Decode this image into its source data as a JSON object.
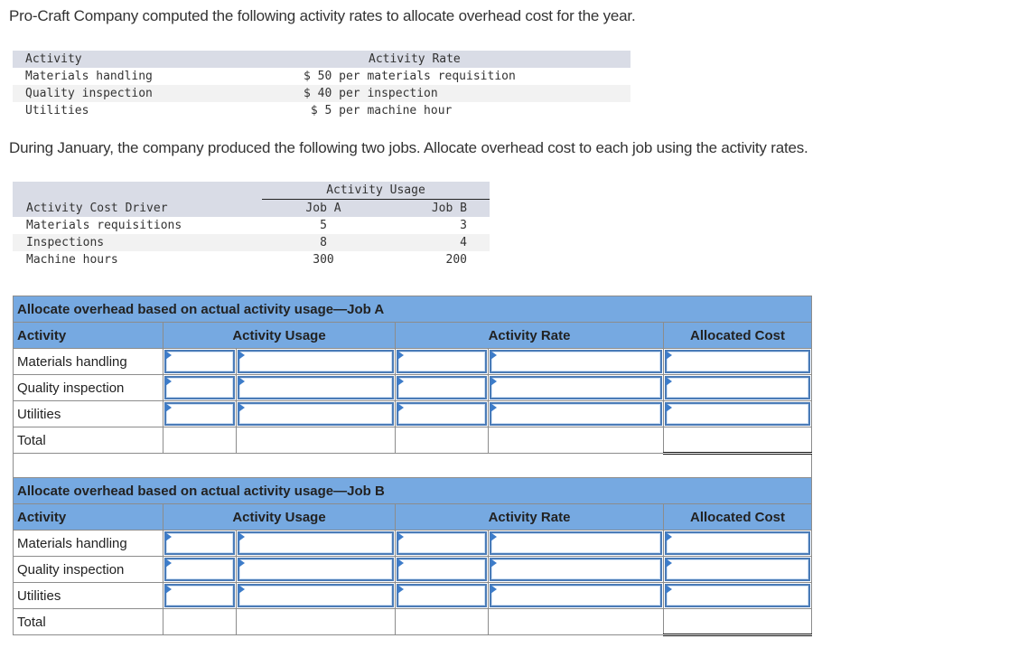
{
  "intro": "Pro-Craft Company computed the following activity rates to allocate overhead cost for the year.",
  "rate_table": {
    "headers": [
      "Activity",
      "Activity Rate"
    ],
    "rows": [
      {
        "activity": "Materials handling",
        "rate": "$ 50 per materials requisition"
      },
      {
        "activity": "Quality inspection",
        "rate": "$ 40 per inspection"
      },
      {
        "activity": "Utilities",
        "rate": " $ 5 per machine hour"
      }
    ]
  },
  "intro2": "During January, the company produced the following two jobs. Allocate overhead cost to each job using the activity rates.",
  "usage_table": {
    "group_header": "Activity Usage",
    "headers": [
      "Activity Cost Driver",
      "Job A",
      "Job B"
    ],
    "rows": [
      {
        "driver": "Materials requisitions",
        "job_a": "5",
        "job_b": "3"
      },
      {
        "driver": "Inspections",
        "job_a": "8",
        "job_b": "4"
      },
      {
        "driver": "Machine hours",
        "job_a": "300",
        "job_b": "200"
      }
    ]
  },
  "alloc_tables": [
    {
      "title": "Allocate overhead based on actual activity usage—Job A",
      "headers": [
        "Activity",
        "Activity Usage",
        "Activity Rate",
        "Allocated Cost"
      ],
      "rows": [
        "Materials handling",
        "Quality inspection",
        "Utilities"
      ],
      "total_label": "Total"
    },
    {
      "title": "Allocate overhead based on actual activity usage—Job B",
      "headers": [
        "Activity",
        "Activity Usage",
        "Activity Rate",
        "Allocated Cost"
      ],
      "rows": [
        "Materials handling",
        "Quality inspection",
        "Utilities"
      ],
      "total_label": "Total"
    }
  ],
  "colors": {
    "header_blue": "#76a9e1",
    "input_border": "#4a7bb7",
    "table_header_gray": "#d9dce6"
  }
}
